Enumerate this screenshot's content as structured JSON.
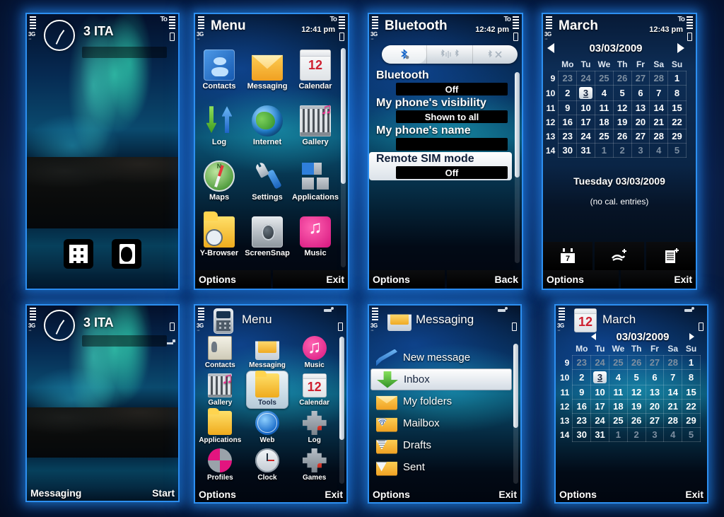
{
  "panels": {
    "home_top": {
      "operator": "3 ITA",
      "network": "3G",
      "icons": [
        "dialer-icon",
        "contacts-icon"
      ]
    },
    "menu_top": {
      "title": "Menu",
      "clock": "12:41 pm",
      "network": "3G",
      "items": [
        {
          "label": "Contacts",
          "icon": "contacts-icon"
        },
        {
          "label": "Messaging",
          "icon": "envelope-icon"
        },
        {
          "label": "Calendar",
          "icon": "calendar-icon"
        },
        {
          "label": "Log",
          "icon": "log-arrows-icon"
        },
        {
          "label": "Internet",
          "icon": "globe-icon"
        },
        {
          "label": "Gallery",
          "icon": "filmstrip-note-icon"
        },
        {
          "label": "Maps",
          "icon": "compass-icon"
        },
        {
          "label": "Settings",
          "icon": "wrench-icon"
        },
        {
          "label": "Applications",
          "icon": "squares-icon"
        },
        {
          "label": "Y-Browser",
          "icon": "folder-magnifier-icon"
        },
        {
          "label": "ScreenSnap",
          "icon": "camera-icon"
        },
        {
          "label": "Music",
          "icon": "music-note-icon"
        }
      ],
      "softkeys": {
        "left": "Options",
        "right": "Exit"
      }
    },
    "bluetooth": {
      "title": "Bluetooth",
      "clock": "12:42 pm",
      "network": "3G",
      "tabs": [
        {
          "icon": "bluetooth-settings-icon",
          "active": true
        },
        {
          "icon": "bluetooth-paired-icon",
          "active": false
        },
        {
          "icon": "bluetooth-blocked-icon",
          "active": false
        }
      ],
      "settings": [
        {
          "label": "Bluetooth",
          "value": "Off",
          "selected": false
        },
        {
          "label": "My phone's visibility",
          "value": "Shown to all",
          "selected": false
        },
        {
          "label": "My phone's name",
          "value": "",
          "selected": false
        },
        {
          "label": "Remote SIM mode",
          "value": "Off",
          "selected": true
        }
      ],
      "softkeys": {
        "left": "Options",
        "right": "Back"
      }
    },
    "calendar_top": {
      "title": "March",
      "clock": "12:43 pm",
      "network": "3G",
      "date": "03/03/2009",
      "weekday_headers": [
        "Mo",
        "Tu",
        "We",
        "Th",
        "Fr",
        "Sa",
        "Su"
      ],
      "week_numbers": [
        "9",
        "10",
        "11",
        "12",
        "13",
        "14"
      ],
      "weeks": [
        [
          {
            "d": "23",
            "dim": true
          },
          {
            "d": "24",
            "dim": true
          },
          {
            "d": "25",
            "dim": true
          },
          {
            "d": "26",
            "dim": true
          },
          {
            "d": "27",
            "dim": true
          },
          {
            "d": "28",
            "dim": true
          },
          {
            "d": "1",
            "dim": false
          }
        ],
        [
          {
            "d": "2",
            "dim": false
          },
          {
            "d": "3",
            "dim": false,
            "selected": true
          },
          {
            "d": "4",
            "dim": false
          },
          {
            "d": "5",
            "dim": false
          },
          {
            "d": "6",
            "dim": false
          },
          {
            "d": "7",
            "dim": false
          },
          {
            "d": "8",
            "dim": false
          }
        ],
        [
          {
            "d": "9",
            "dim": false
          },
          {
            "d": "10",
            "dim": false
          },
          {
            "d": "11",
            "dim": false
          },
          {
            "d": "12",
            "dim": false
          },
          {
            "d": "13",
            "dim": false
          },
          {
            "d": "14",
            "dim": false
          },
          {
            "d": "15",
            "dim": false
          }
        ],
        [
          {
            "d": "16",
            "dim": false
          },
          {
            "d": "17",
            "dim": false
          },
          {
            "d": "18",
            "dim": false
          },
          {
            "d": "19",
            "dim": false
          },
          {
            "d": "20",
            "dim": false
          },
          {
            "d": "21",
            "dim": false
          },
          {
            "d": "22",
            "dim": false
          }
        ],
        [
          {
            "d": "23",
            "dim": false
          },
          {
            "d": "24",
            "dim": false
          },
          {
            "d": "25",
            "dim": false
          },
          {
            "d": "26",
            "dim": false
          },
          {
            "d": "27",
            "dim": false
          },
          {
            "d": "28",
            "dim": false
          },
          {
            "d": "29",
            "dim": false
          }
        ],
        [
          {
            "d": "30",
            "dim": false
          },
          {
            "d": "31",
            "dim": false
          },
          {
            "d": "1",
            "dim": true
          },
          {
            "d": "2",
            "dim": true
          },
          {
            "d": "3",
            "dim": true
          },
          {
            "d": "4",
            "dim": true
          },
          {
            "d": "5",
            "dim": true
          }
        ]
      ],
      "selected_day_label": "Tuesday 03/03/2009",
      "no_entries": "(no cal. entries)",
      "toolbar_icons": [
        "new-meeting-icon",
        "new-anniversary-icon",
        "new-todo-icon"
      ],
      "softkeys": {
        "left": "Options",
        "right": "Exit"
      }
    },
    "home_bottom": {
      "operator": "3 ITA",
      "network": "3G",
      "softkeys": {
        "left": "Messaging",
        "right": "Start"
      }
    },
    "menu_bottom": {
      "title": "Menu",
      "network": "3G",
      "header_icon": "phone-menu-icon",
      "items": [
        {
          "label": "Contacts",
          "icon": "business-cards-icon"
        },
        {
          "label": "Messaging",
          "icon": "envelope-icon"
        },
        {
          "label": "Music",
          "icon": "music-note-icon"
        },
        {
          "label": "Gallery",
          "icon": "filmstrip-note-icon"
        },
        {
          "label": "Tools",
          "icon": "folder-wrench-icon",
          "selected": true
        },
        {
          "label": "Calendar",
          "icon": "calendar-icon"
        },
        {
          "label": "Applications",
          "icon": "folder-icon"
        },
        {
          "label": "Web",
          "icon": "web-globe-icon"
        },
        {
          "label": "Log",
          "icon": "log-phone-icon"
        },
        {
          "label": "Profiles",
          "icon": "profiles-pie-icon"
        },
        {
          "label": "Clock",
          "icon": "clock-icon"
        },
        {
          "label": "Games",
          "icon": "games-puzzle-icon"
        }
      ],
      "softkeys": {
        "left": "Options",
        "right": "Exit"
      }
    },
    "messaging": {
      "title": "Messaging",
      "network": "3G",
      "header_icon": "messaging-icon",
      "items": [
        {
          "label": "New message",
          "icon": "pencil-icon",
          "selected": false
        },
        {
          "label": "Inbox",
          "icon": "inbox-download-icon",
          "selected": true
        },
        {
          "label": "My folders",
          "icon": "folders-envelope-icon",
          "selected": false
        },
        {
          "label": "Mailbox",
          "icon": "mailbox-at-icon",
          "selected": false
        },
        {
          "label": "Drafts",
          "icon": "drafts-envelope-icon",
          "selected": false
        },
        {
          "label": "Sent",
          "icon": "sent-envelope-icon",
          "selected": false
        }
      ],
      "softkeys": {
        "left": "Options",
        "right": "Exit"
      }
    },
    "calendar_bottom": {
      "title": "March",
      "network": "3G",
      "header_icon": "calendar-icon",
      "date": "03/03/2009",
      "weekday_headers": [
        "Mo",
        "Tu",
        "We",
        "Th",
        "Fr",
        "Sa",
        "Su"
      ],
      "week_numbers": [
        "9",
        "10",
        "11",
        "12",
        "13",
        "14"
      ],
      "weeks": [
        [
          {
            "d": "23",
            "dim": true
          },
          {
            "d": "24",
            "dim": true
          },
          {
            "d": "25",
            "dim": true
          },
          {
            "d": "26",
            "dim": true
          },
          {
            "d": "27",
            "dim": true
          },
          {
            "d": "28",
            "dim": true
          },
          {
            "d": "1",
            "dim": false
          }
        ],
        [
          {
            "d": "2",
            "dim": false
          },
          {
            "d": "3",
            "dim": false,
            "selected": true
          },
          {
            "d": "4",
            "dim": false
          },
          {
            "d": "5",
            "dim": false
          },
          {
            "d": "6",
            "dim": false
          },
          {
            "d": "7",
            "dim": false
          },
          {
            "d": "8",
            "dim": false
          }
        ],
        [
          {
            "d": "9",
            "dim": false
          },
          {
            "d": "10",
            "dim": false
          },
          {
            "d": "11",
            "dim": false
          },
          {
            "d": "12",
            "dim": false
          },
          {
            "d": "13",
            "dim": false
          },
          {
            "d": "14",
            "dim": false
          },
          {
            "d": "15",
            "dim": false
          }
        ],
        [
          {
            "d": "16",
            "dim": false
          },
          {
            "d": "17",
            "dim": false
          },
          {
            "d": "18",
            "dim": false
          },
          {
            "d": "19",
            "dim": false
          },
          {
            "d": "20",
            "dim": false
          },
          {
            "d": "21",
            "dim": false
          },
          {
            "d": "22",
            "dim": false
          }
        ],
        [
          {
            "d": "23",
            "dim": false
          },
          {
            "d": "24",
            "dim": false
          },
          {
            "d": "25",
            "dim": false
          },
          {
            "d": "26",
            "dim": false
          },
          {
            "d": "27",
            "dim": false
          },
          {
            "d": "28",
            "dim": false
          },
          {
            "d": "29",
            "dim": false
          }
        ],
        [
          {
            "d": "30",
            "dim": false
          },
          {
            "d": "31",
            "dim": false
          },
          {
            "d": "1",
            "dim": true
          },
          {
            "d": "2",
            "dim": true
          },
          {
            "d": "3",
            "dim": true
          },
          {
            "d": "4",
            "dim": true
          },
          {
            "d": "5",
            "dim": true
          }
        ]
      ],
      "softkeys": {
        "left": "Options",
        "right": "Exit"
      }
    }
  },
  "colors": {
    "accent": "#2d8ff0",
    "background": "#05122e",
    "highlight": "#ffffff"
  }
}
